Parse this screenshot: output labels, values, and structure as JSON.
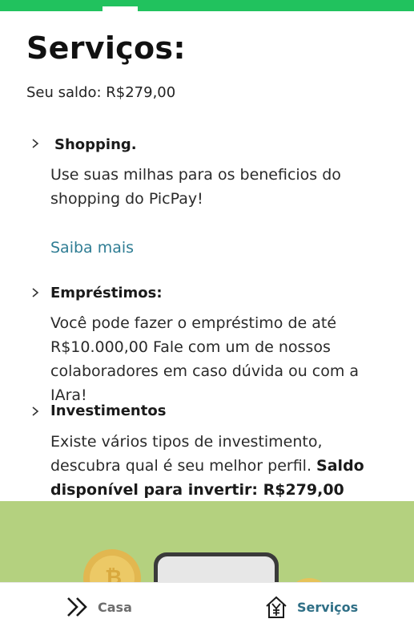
{
  "page": {
    "title": "Serviços:",
    "balance": "Seu saldo: R$279,00"
  },
  "sections": [
    {
      "title": "Shopping.",
      "body": "Use suas milhas para os beneficios do shopping do PicPay!",
      "link": "Saiba mais"
    },
    {
      "title": "Empréstimos:",
      "body": "Você pode fazer o empréstimo de até R$10.000,00  Fale com um de nossos colaboradores em caso dúvida ou com a IAra!"
    },
    {
      "title": "Investimentos",
      "body": "Existe vários tipos de investimento, descubra qual é seu melhor perfil. ",
      "body_bold": "Saldo disponível para invertir: R$279,00"
    }
  ],
  "bottom_nav": {
    "items": [
      {
        "label": "Casa",
        "icon": "double-chevron-right-icon"
      },
      {
        "label": "Serviços",
        "icon": "yen-house-icon"
      }
    ]
  },
  "colors": {
    "top_bar": "#21c25e",
    "banner": "#b4d17f",
    "link": "#2f7d94",
    "nav_active": "#2f6f86",
    "nav_inactive": "#6d6d6d"
  }
}
